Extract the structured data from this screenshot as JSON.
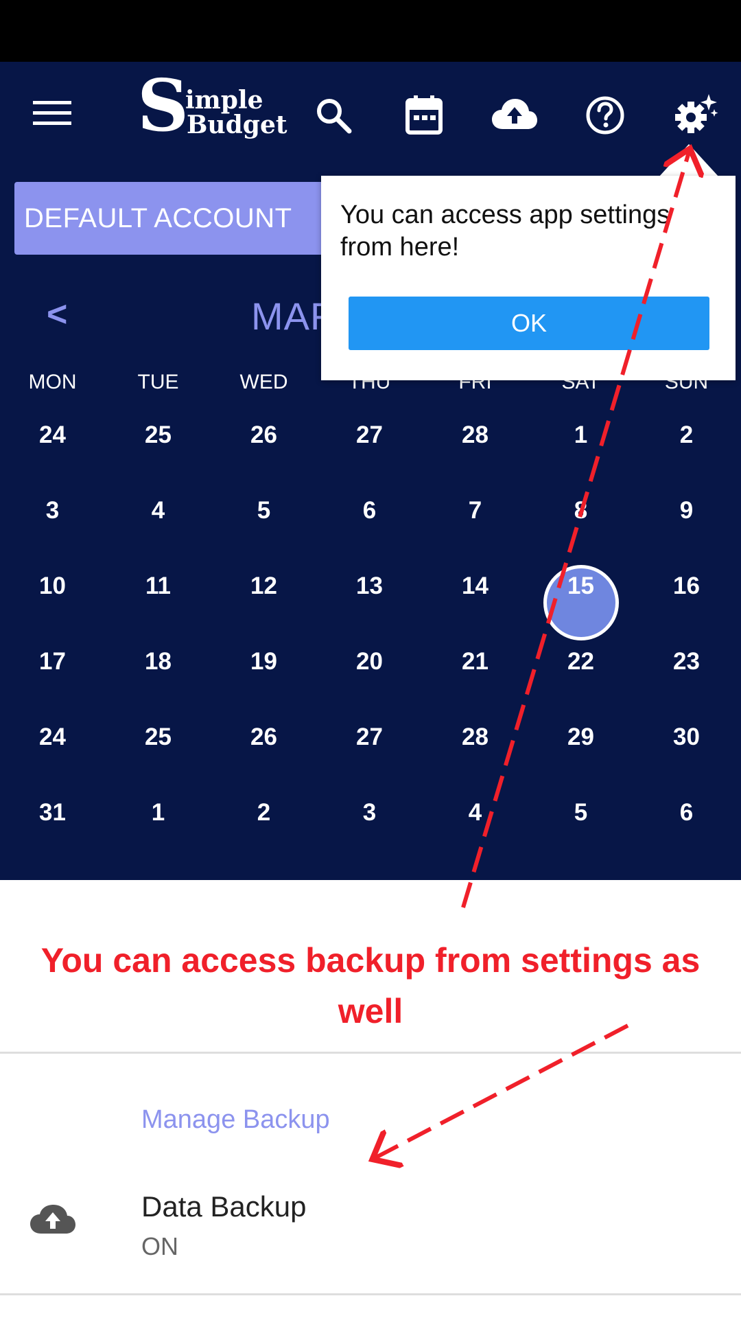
{
  "app": {
    "logo_big_letter": "S",
    "logo_word1": "imple",
    "logo_word2": "Budget"
  },
  "toolbar": {
    "menu_icon": "hamburger-menu-icon",
    "search_icon": "search-icon",
    "calendar_icon": "calendar-icon",
    "backup_icon": "cloud-upload-icon",
    "help_icon": "help-circle-icon",
    "settings_icon": "settings-gear-icon"
  },
  "account": {
    "label": "DEFAULT ACCOUNT"
  },
  "calendar": {
    "prev_label": "<",
    "month_visible": "MAF",
    "weekdays": [
      "MON",
      "TUE",
      "WED",
      "THU",
      "FRI",
      "SAT",
      "SUN"
    ],
    "weeks": [
      [
        "24",
        "25",
        "26",
        "27",
        "28",
        "1",
        "2"
      ],
      [
        "3",
        "4",
        "5",
        "6",
        "7",
        "8",
        "9"
      ],
      [
        "10",
        "11",
        "12",
        "13",
        "14",
        "15",
        "16"
      ],
      [
        "17",
        "18",
        "19",
        "20",
        "21",
        "22",
        "23"
      ],
      [
        "24",
        "25",
        "26",
        "27",
        "28",
        "29",
        "30"
      ],
      [
        "31",
        "1",
        "2",
        "3",
        "4",
        "5",
        "6"
      ]
    ],
    "selected_day": "15"
  },
  "tooltip": {
    "text": "You can access app settings from here!",
    "ok_label": "OK"
  },
  "annotation": {
    "line1": "You can access backup from settings as",
    "line2": "well",
    "color": "#f0202a"
  },
  "settings": {
    "category": "Manage Backup",
    "item_title": "Data Backup",
    "item_summary": "ON"
  },
  "colors": {
    "appbar": "#071647",
    "accent": "#8c93ee",
    "ok_button": "#2196f3",
    "today": "#6f86df"
  }
}
